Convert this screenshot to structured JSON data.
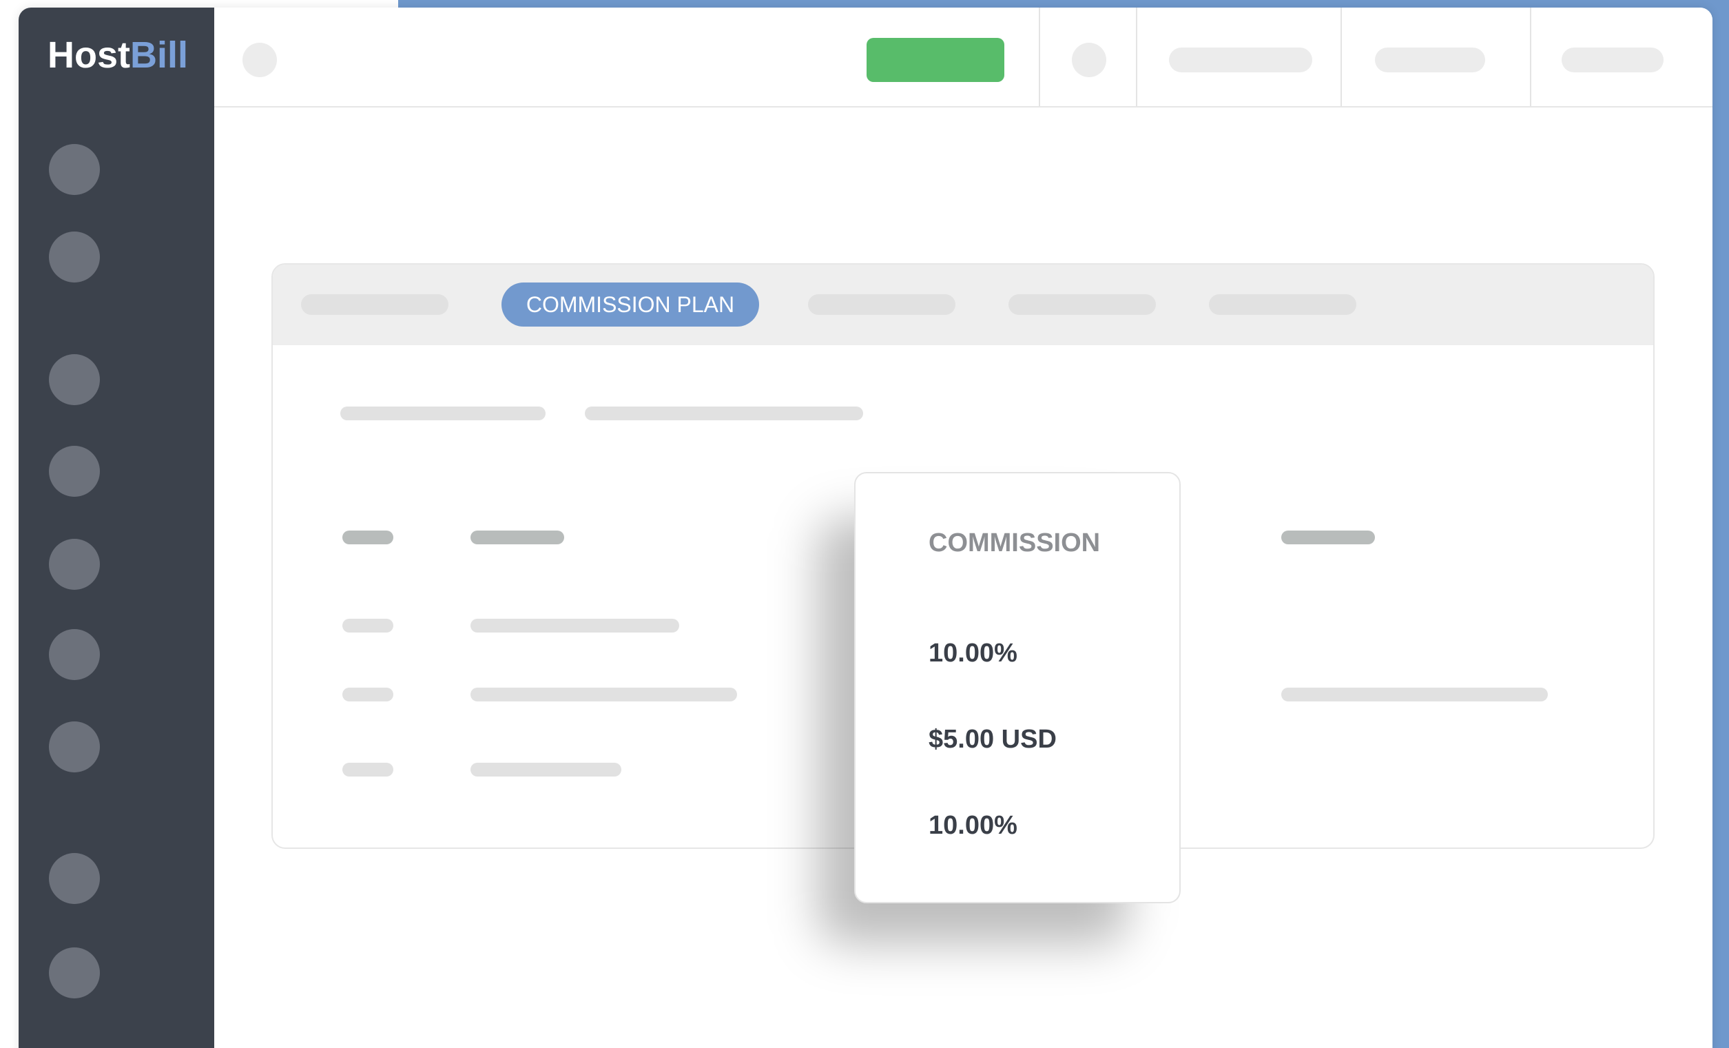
{
  "app": {
    "logo_part1": "Host",
    "logo_part2": "Bill"
  },
  "tabs": {
    "active_label": "COMMISSION PLAN"
  },
  "commission_popup": {
    "title": "COMMISSION",
    "values": [
      "10.00%",
      "$5.00 USD",
      "10.00%"
    ]
  },
  "colors": {
    "sidebar": "#3c424c",
    "accent_blue": "#7299ce",
    "green_button": "#58bc6a"
  }
}
